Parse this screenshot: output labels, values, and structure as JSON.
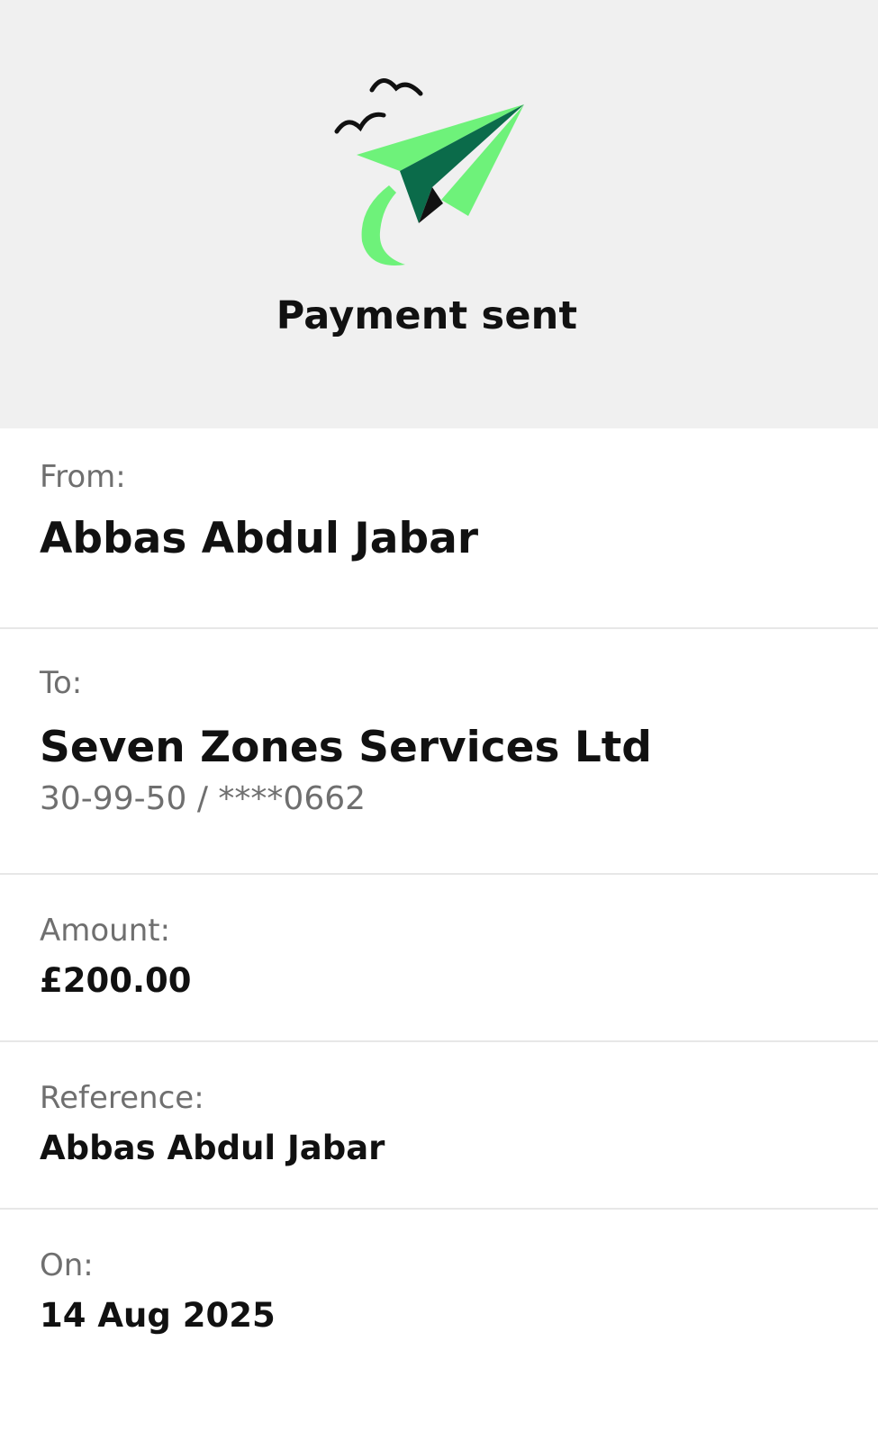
{
  "header": {
    "title": "Payment sent",
    "illustration": "paper-plane-with-birds",
    "colors": {
      "background": "#f0f0f0",
      "plane_light": "#6ef27a",
      "plane_dark": "#0b6b4a",
      "birds": "#111111"
    }
  },
  "details": {
    "from": {
      "label": "From:",
      "name": "Abbas Abdul Jabar"
    },
    "to": {
      "label": "To:",
      "name": "Seven Zones Services Ltd",
      "account": "30-99-50 / ****0662"
    },
    "amount": {
      "label": "Amount:",
      "value": "£200.00"
    },
    "reference": {
      "label": "Reference:",
      "value": "Abbas Abdul Jabar"
    },
    "date": {
      "label": "On:",
      "value": "14 Aug 2025"
    }
  }
}
